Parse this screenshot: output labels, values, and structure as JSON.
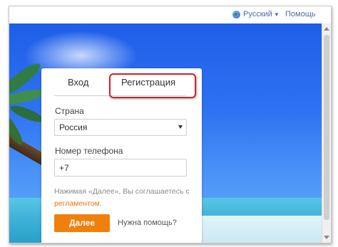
{
  "topbar": {
    "language_label": "Русский",
    "help_label": "Помощь"
  },
  "form": {
    "tabs": [
      {
        "label": "Вход",
        "active": false
      },
      {
        "label": "Регистрация",
        "active": true
      }
    ],
    "country_label": "Страна",
    "country_value": "Россия",
    "phone_label": "Номер телефона",
    "phone_value": "+7",
    "terms_text": "Нажимая «Далее», Вы соглашаетесь с",
    "terms_link": "регламентом",
    "terms_end": ".",
    "next_button": "Далее",
    "help_link": "Нужна помощь?"
  },
  "colors": {
    "accent": "#f17f0b",
    "link": "#e87511",
    "highlight": "#c9252c",
    "background": "#2f72f2"
  },
  "icons": {
    "language": "globe-icon",
    "dropdown": "caret-down-icon"
  }
}
